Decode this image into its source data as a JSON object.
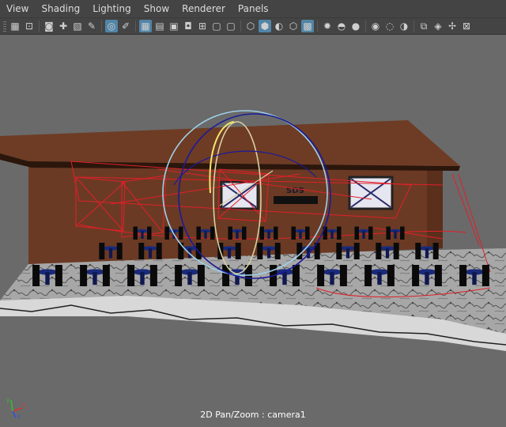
{
  "menubar": {
    "items": [
      {
        "label": "View"
      },
      {
        "label": "Shading"
      },
      {
        "label": "Lighting"
      },
      {
        "label": "Show"
      },
      {
        "label": "Renderer"
      },
      {
        "label": "Panels"
      }
    ]
  },
  "toolbar": {
    "buttons": [
      {
        "name": "camera-select-icon",
        "glyph": "▦",
        "active": false
      },
      {
        "name": "camera-lock-icon",
        "glyph": "⊡",
        "active": false
      },
      {
        "name": "camera-attributes-icon",
        "glyph": "◙",
        "active": false
      },
      {
        "name": "bookmark-icon",
        "glyph": "✚",
        "active": false
      },
      {
        "name": "image-plane-icon",
        "glyph": "▧",
        "active": false
      },
      {
        "name": "grease-pencil-icon",
        "glyph": "✎",
        "active": false
      },
      {
        "name": "pan-zoom-icon",
        "glyph": "◎",
        "active": true
      },
      {
        "name": "2d-pencil-icon",
        "glyph": "✐",
        "active": false
      },
      {
        "name": "grid-icon",
        "glyph": "▦",
        "active": true
      },
      {
        "name": "film-gate-icon",
        "glyph": "▤",
        "active": false
      },
      {
        "name": "resolution-gate-icon",
        "glyph": "▣",
        "active": false
      },
      {
        "name": "gate-mask-icon",
        "glyph": "◘",
        "active": false
      },
      {
        "name": "field-chart-icon",
        "glyph": "⊞",
        "active": false
      },
      {
        "name": "safe-action-icon",
        "glyph": "▢",
        "active": false
      },
      {
        "name": "safe-title-icon",
        "glyph": "▢",
        "active": false
      },
      {
        "name": "wireframe-icon",
        "glyph": "⬡",
        "active": false
      },
      {
        "name": "smooth-shade-icon",
        "glyph": "⬢",
        "active": true
      },
      {
        "name": "default-material-icon",
        "glyph": "◐",
        "active": false
      },
      {
        "name": "wireframe-on-shaded-icon",
        "glyph": "⬡",
        "active": false
      },
      {
        "name": "textured-icon",
        "glyph": "▩",
        "active": true
      },
      {
        "name": "use-lights-icon",
        "glyph": "✹",
        "active": false
      },
      {
        "name": "shadows-icon",
        "glyph": "◓",
        "active": false
      },
      {
        "name": "screen-space-ao-icon",
        "glyph": "●",
        "active": false
      },
      {
        "name": "motion-blur-icon",
        "glyph": "◉",
        "active": false
      },
      {
        "name": "multisample-aa-icon",
        "glyph": "◌",
        "active": false
      },
      {
        "name": "depth-of-field-icon",
        "glyph": "◑",
        "active": false
      },
      {
        "name": "isolate-select-icon",
        "glyph": "⧉",
        "active": false
      },
      {
        "name": "xray-icon",
        "glyph": "◈",
        "active": false
      },
      {
        "name": "xray-joints-icon",
        "glyph": "✢",
        "active": false
      },
      {
        "name": "xray-components-icon",
        "glyph": "⊠",
        "active": false
      }
    ]
  },
  "viewport": {
    "hud_label": "2D Pan/Zoom : camera1",
    "background": "#6a6a6a",
    "axis_labels": {
      "x": "x",
      "y": "y",
      "z": "z"
    }
  },
  "colors": {
    "menubar_bg": "#444444",
    "active_button": "#5285a6",
    "wall": "#6b3a24",
    "roof_edge": "#3a1d10",
    "floor": "#9a9a9a",
    "light_wire": "#e0202a",
    "manip_ring_outer": "#9fd0e8",
    "manip_ring_inner": "#d8d0a0",
    "chair": "#0a0a0a",
    "table_top": "#1a2a7a"
  },
  "scene_text": {
    "sign": "SDS"
  }
}
